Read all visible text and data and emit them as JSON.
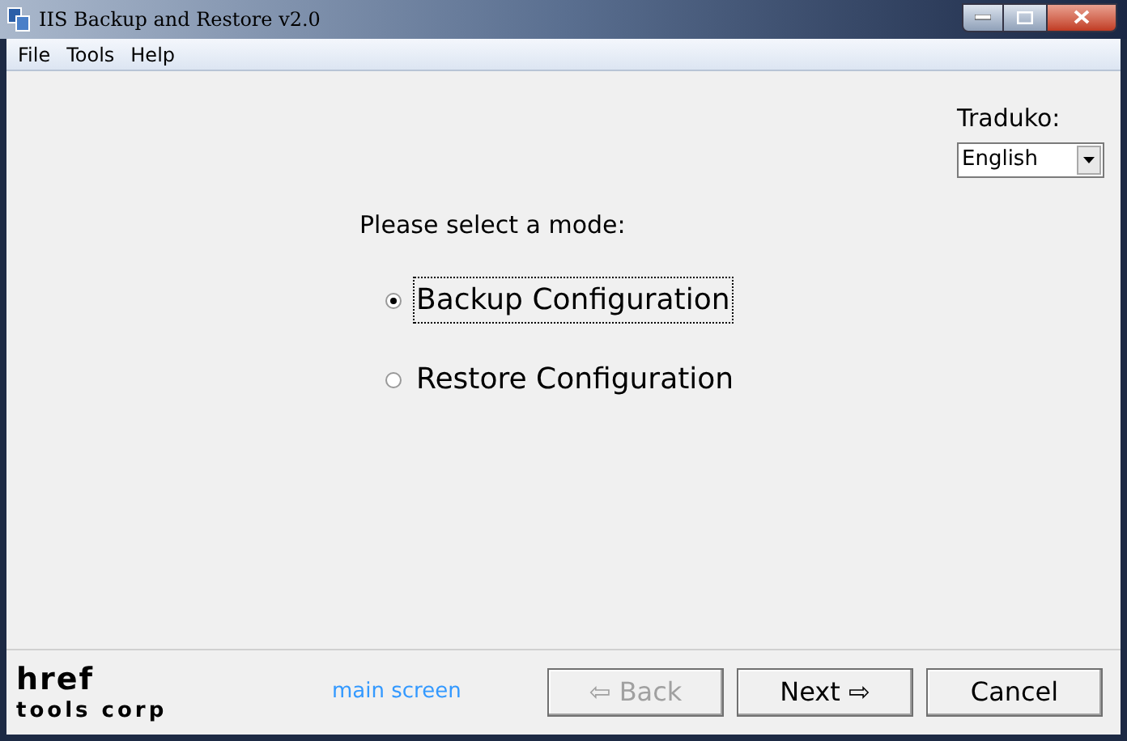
{
  "window": {
    "title": "IIS Backup and Restore v2.0"
  },
  "menu": [
    "File",
    "Tools",
    "Help"
  ],
  "language": {
    "label": "Traduko:",
    "value": "English"
  },
  "prompt": "Please select a mode:",
  "modes": [
    {
      "label": "Backup Configuration",
      "selected": true
    },
    {
      "label": "Restore Configuration",
      "selected": false
    }
  ],
  "footer": {
    "logo_top": "href",
    "logo_bottom": "tools corp",
    "link": "main screen",
    "buttons": [
      {
        "label": "⇦ Back",
        "disabled": true
      },
      {
        "label": "Next ⇨",
        "disabled": false
      },
      {
        "label": "Cancel",
        "disabled": false
      }
    ]
  }
}
